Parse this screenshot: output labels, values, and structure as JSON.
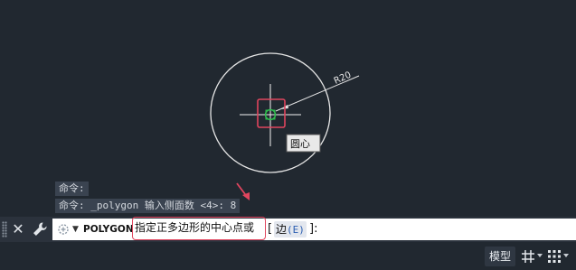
{
  "viewport": {
    "radius_label": "R20",
    "osnap_tooltip": "圆心"
  },
  "history": [
    "命令:",
    "命令: _polygon 输入侧面数 <4>: 8"
  ],
  "command_line": {
    "command": "POLYGON",
    "prompt": "指定正多边形的中心点或",
    "bracket_open": "[",
    "option_label": "边",
    "option_key": "(E)",
    "bracket_close": "]:"
  },
  "status_bar": {
    "model_tab": "模型"
  },
  "colors": {
    "background": "#212830",
    "highlight": "#e0455e",
    "snap_marker": "#2fbf4f"
  }
}
